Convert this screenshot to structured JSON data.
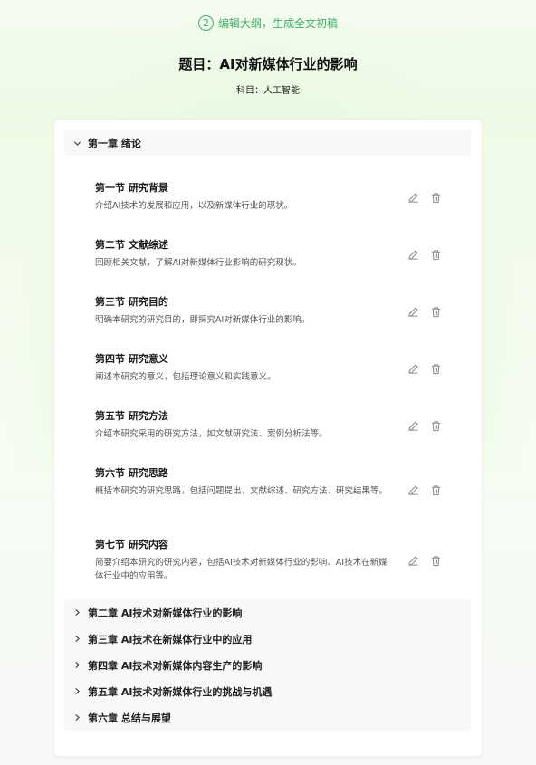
{
  "step": {
    "number": "2",
    "label": "编辑大纲，生成全文初稿"
  },
  "title": "题目：AI对新媒体行业的影响",
  "subject": "科目：人工智能",
  "chapter1": {
    "label": "第一章 绪论",
    "sections": [
      {
        "title": "第一节 研究背景",
        "desc": "介绍AI技术的发展和应用，以及新媒体行业的现状。"
      },
      {
        "title": "第二节 文献综述",
        "desc": "回顾相关文献，了解AI对新媒体行业影响的研究现状。"
      },
      {
        "title": "第三节 研究目的",
        "desc": "明确本研究的研究目的，即探究AI对新媒体行业的影响。"
      },
      {
        "title": "第四节 研究意义",
        "desc": "阐述本研究的意义，包括理论意义和实践意义。"
      },
      {
        "title": "第五节 研究方法",
        "desc": "介绍本研究采用的研究方法，如文献研究法、案例分析法等。"
      },
      {
        "title": "第六节 研究思路",
        "desc": "概括本研究的研究思路，包括问题提出、文献综述、研究方法、研究结果等。"
      },
      {
        "title": "第七节 研究内容",
        "desc": "简要介绍本研究的研究内容，包括AI技术对新媒体行业的影响、AI技术在新媒体行业中的应用等。"
      }
    ]
  },
  "chapters": [
    {
      "label": "第二章 AI技术对新媒体行业的影响"
    },
    {
      "label": "第三章 AI技术在新媒体行业中的应用"
    },
    {
      "label": "第四章 AI技术对新媒体内容生产的影响"
    },
    {
      "label": "第五章 AI技术对新媒体行业的挑战与机遇"
    },
    {
      "label": "第六章 总结与展望"
    }
  ],
  "colors": {
    "accent": "#3fae66",
    "icon": "#8a8a8a"
  },
  "icons": {
    "edit": "pencil-icon",
    "delete": "trash-icon",
    "expanded": "chevron-down-icon",
    "collapsed": "chevron-right-icon"
  }
}
